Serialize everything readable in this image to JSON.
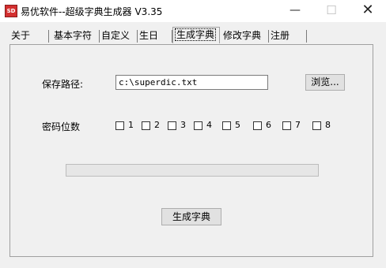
{
  "window": {
    "title": "易优软件--超级字典生成器 V3.35",
    "icon_text": "SD",
    "minimize": "—",
    "maximize": "☐",
    "close": "✕"
  },
  "tabs": [
    {
      "label": "关于",
      "active": false
    },
    {
      "label": "基本字符",
      "active": false
    },
    {
      "label": "自定义",
      "active": false
    },
    {
      "label": "生日",
      "active": false
    },
    {
      "label": "生成字典",
      "active": true
    },
    {
      "label": "修改字典",
      "active": false
    },
    {
      "label": "注册",
      "active": false
    }
  ],
  "form": {
    "save_path_label": "保存路径:",
    "save_path_value": "c:\\superdic.txt",
    "browse_label": "浏览...",
    "digits_label": "密码位数",
    "digit_options": [
      {
        "label": "1",
        "checked": false
      },
      {
        "label": "2",
        "checked": false
      },
      {
        "label": "3",
        "checked": false
      },
      {
        "label": "4",
        "checked": false
      },
      {
        "label": "5",
        "checked": false
      },
      {
        "label": "6",
        "checked": false
      },
      {
        "label": "7",
        "checked": false
      },
      {
        "label": "8",
        "checked": false
      }
    ],
    "progress_percent": 0,
    "generate_label": "生成字典"
  }
}
